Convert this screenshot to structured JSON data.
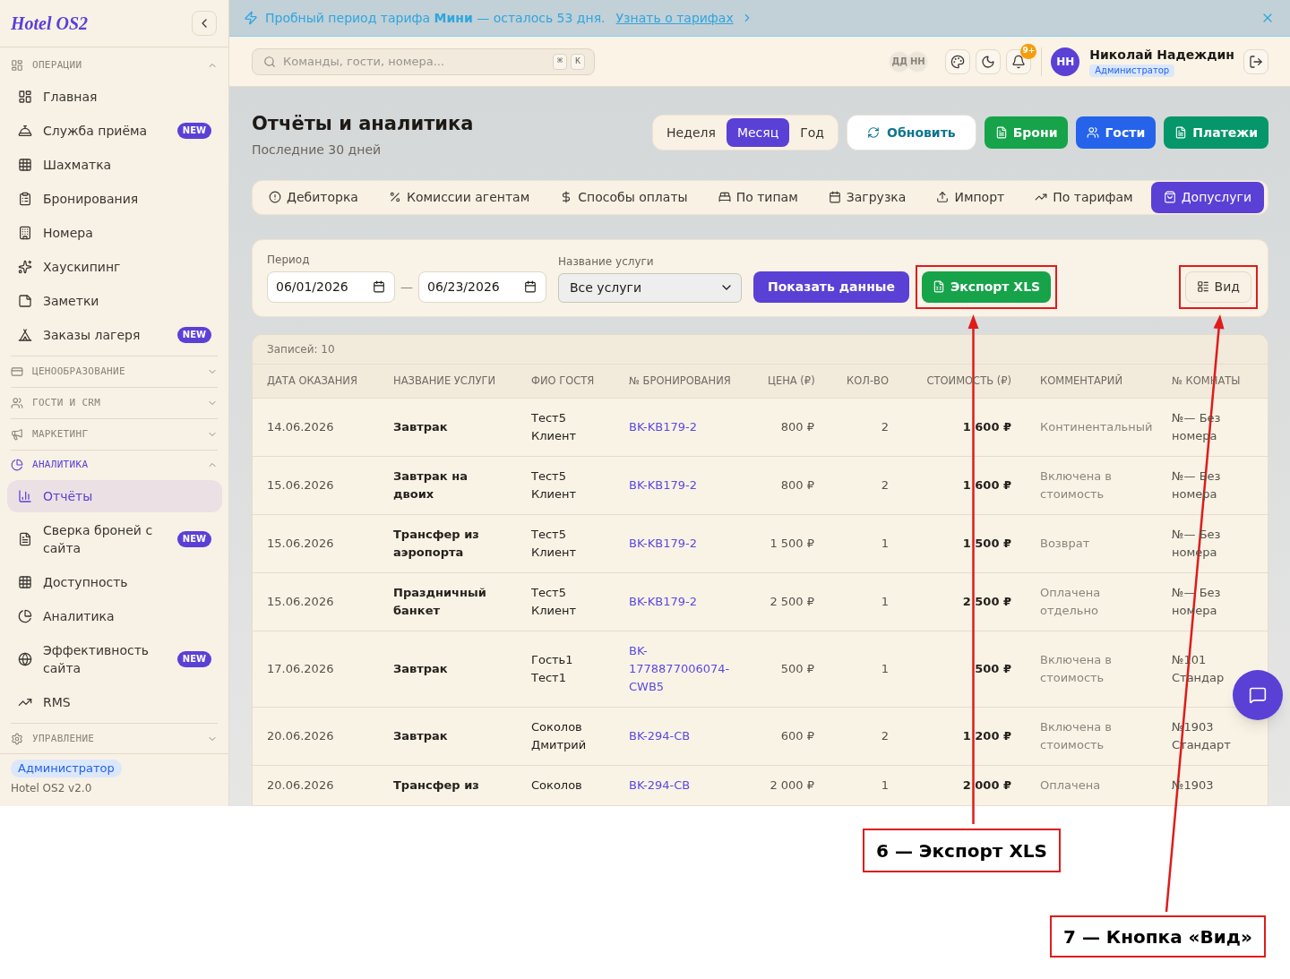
{
  "sidebar": {
    "logo": "Hotel OS2",
    "sections": [
      {
        "title": "ОПЕРАЦИИ",
        "expanded": true,
        "current": false,
        "items": [
          {
            "label": "Главная",
            "selected": false
          },
          {
            "label": "Служба приёма",
            "badge": "NEW",
            "selected": false
          },
          {
            "label": "Шахматка",
            "selected": false
          },
          {
            "label": "Бронирования",
            "selected": false
          },
          {
            "label": "Номера",
            "selected": false
          },
          {
            "label": "Хаускипинг",
            "selected": false
          },
          {
            "label": "Заметки",
            "selected": false
          },
          {
            "label": "Заказы лагеря",
            "badge": "NEW",
            "selected": false
          }
        ]
      },
      {
        "title": "ЦЕНООБРАЗОВАНИЕ",
        "expanded": false,
        "current": false
      },
      {
        "title": "ГОСТИ И CRM",
        "expanded": false,
        "current": false
      },
      {
        "title": "МАРКЕТИНГ",
        "expanded": false,
        "current": false
      },
      {
        "title": "АНАЛИТИКА",
        "expanded": true,
        "current": true,
        "items": [
          {
            "label": "Отчёты",
            "selected": true
          },
          {
            "label": "Сверка броней с сайта",
            "badge": "NEW",
            "selected": false
          },
          {
            "label": "Доступность",
            "selected": false
          },
          {
            "label": "Аналитика",
            "selected": false
          },
          {
            "label": "Эффективность сайта",
            "badge": "NEW",
            "selected": false
          },
          {
            "label": "RMS",
            "selected": false
          }
        ]
      },
      {
        "title": "УПРАВЛЕНИЕ",
        "expanded": false,
        "current": false
      }
    ],
    "footer": {
      "role": "Администратор",
      "version": "Hotel OS2 v2.0"
    }
  },
  "banner": {
    "message": "Пробный период тарифа **Мини** — осталось 53 дня.",
    "link": "Узнать о тарифах"
  },
  "topbar": {
    "search": {
      "placeholder": "Команды, гости, номера...",
      "keys": [
        "⌘",
        "K"
      ]
    },
    "presence": [
      "ДД",
      "НН"
    ],
    "notification_count": "9+",
    "user": {
      "initials": "НН",
      "name": "Николай Надеждин",
      "role": "Администратор"
    }
  },
  "page": {
    "title": "Отчёты и аналитика",
    "subtitle": "Последние 30 дней",
    "periods": [
      {
        "label": "Неделя",
        "selected": false
      },
      {
        "label": "Месяц",
        "selected": true
      },
      {
        "label": "Год",
        "selected": false
      }
    ],
    "refresh": "Обновить",
    "actions": [
      {
        "label": "Брони",
        "color": "#16a34a"
      },
      {
        "label": "Гости",
        "color": "#2563eb"
      },
      {
        "label": "Платежи",
        "color": "#059669"
      }
    ]
  },
  "report_tabs": [
    {
      "label": "Дебиторка",
      "selected": false
    },
    {
      "label": "Комиссии агентам",
      "selected": false
    },
    {
      "label": "Способы оплаты",
      "selected": false
    },
    {
      "label": "По типам",
      "selected": false
    },
    {
      "label": "Загрузка",
      "selected": false
    },
    {
      "label": "Импорт",
      "selected": false
    },
    {
      "label": "По тарифам",
      "selected": false
    },
    {
      "label": "Допуслуги",
      "selected": true
    }
  ],
  "filters": {
    "period_label": "Период",
    "date_from": "06/01/2026",
    "separator": "—",
    "date_to": "06/23/2026",
    "service_label": "Название услуги",
    "service_value": "Все услуги",
    "show_button": "Показать данные",
    "export_button": {
      "label": "Экспорт XLS",
      "highlighted": true
    },
    "view_button": {
      "label": "Вид",
      "highlighted": true
    }
  },
  "table": {
    "count": "Записей: 10",
    "columns": [
      "ДАТА ОКАЗАНИЯ",
      "НАЗВАНИЕ УСЛУГИ",
      "ФИО ГОСТЯ",
      "№ БРОНИРОВАНИЯ",
      "ЦЕНА (₽)",
      "КОЛ-ВО",
      "СТОИМОСТЬ (₽)",
      "КОММЕНТАРИЙ",
      "№ КОМНАТЫ"
    ],
    "rows": [
      {
        "date": "14.06.2026",
        "service": "Завтрак",
        "guest": "Тест5 Клиент",
        "booking": "BK-KB179-2",
        "price": "800 ₽",
        "qty": "2",
        "cost": "1 600 ₽",
        "comment": "Континентальный",
        "room": "№— Без номера"
      },
      {
        "date": "15.06.2026",
        "service": "Завтрак на двоих",
        "guest": "Тест5 Клиент",
        "booking": "BK-KB179-2",
        "price": "800 ₽",
        "qty": "2",
        "cost": "1 600 ₽",
        "comment": "Включена в стоимость",
        "room": "№— Без номера"
      },
      {
        "date": "15.06.2026",
        "service": "Трансфер из аэропорта",
        "guest": "Тест5 Клиент",
        "booking": "BK-KB179-2",
        "price": "1 500 ₽",
        "qty": "1",
        "cost": "1 500 ₽",
        "comment": "Возврат",
        "room": "№— Без номера"
      },
      {
        "date": "15.06.2026",
        "service": "Праздничный банкет",
        "guest": "Тест5 Клиент",
        "booking": "BK-KB179-2",
        "price": "2 500 ₽",
        "qty": "1",
        "cost": "2 500 ₽",
        "comment": "Оплачена отдельно",
        "room": "№— Без номера"
      },
      {
        "date": "17.06.2026",
        "service": "Завтрак",
        "guest": "Гость1 Тест1",
        "booking": "BK-1778877006074-CWB5",
        "price": "500 ₽",
        "qty": "1",
        "cost": "500 ₽",
        "comment": "Включена в стоимость",
        "room": "№101 Стандар"
      },
      {
        "date": "20.06.2026",
        "service": "Завтрак",
        "guest": "Соколов Дмитрий",
        "booking": "BK-294-CB",
        "price": "600 ₽",
        "qty": "2",
        "cost": "1 200 ₽",
        "comment": "Включена в стоимость",
        "room": "№1903 Стандарт"
      },
      {
        "date": "20.06.2026",
        "service": "Трансфер из",
        "guest": "Соколов",
        "booking": "BK-294-CB",
        "price": "2 000 ₽",
        "qty": "1",
        "cost": "2 000 ₽",
        "comment": "Оплачена",
        "room": "№1903"
      }
    ]
  },
  "annotations": [
    {
      "text": "6 — Экспорт XLS"
    },
    {
      "text": "7 — Кнопка «Вид»"
    }
  ]
}
